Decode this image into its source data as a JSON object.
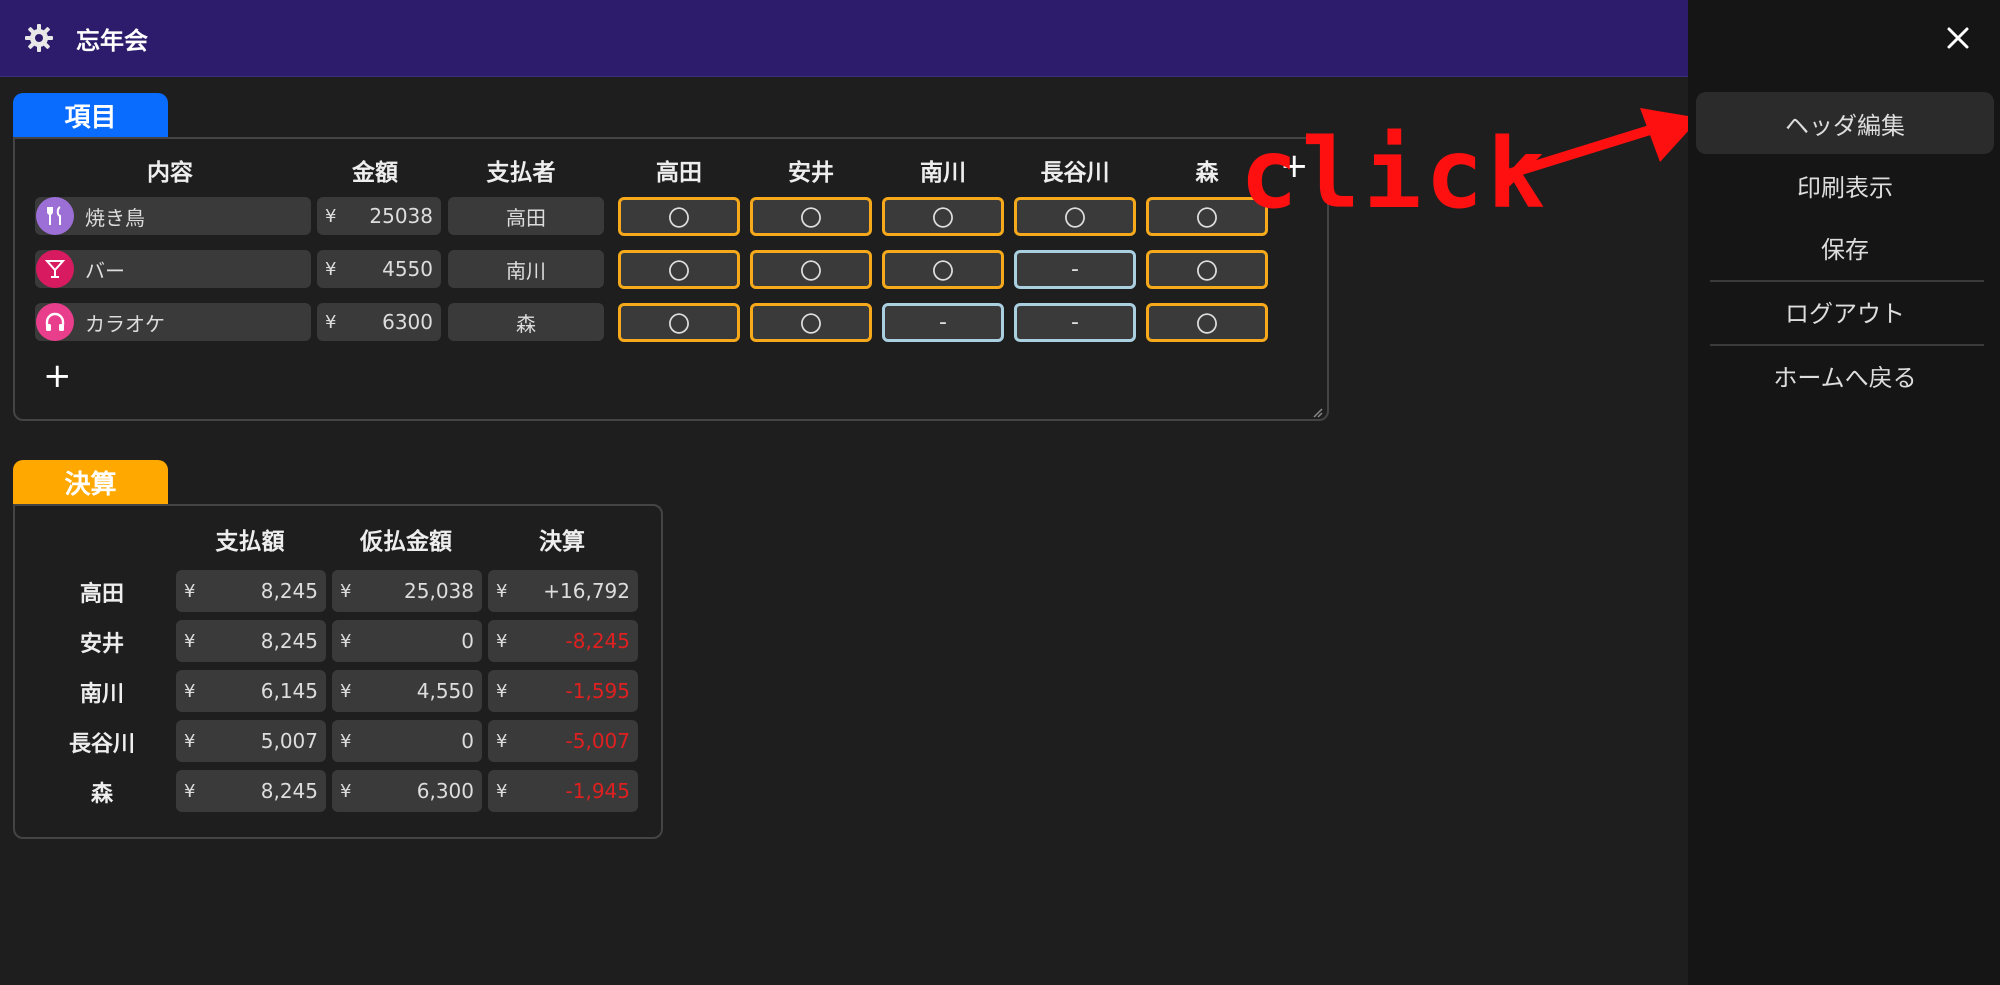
{
  "app": {
    "title": "忘年会"
  },
  "items_section": {
    "tab_label": "項目",
    "headers": {
      "content": "内容",
      "amount": "金額",
      "payer": "支払者"
    },
    "members": [
      "高田",
      "安井",
      "南川",
      "長谷川",
      "森"
    ],
    "add_member_symbol": "+",
    "add_row_symbol": "+",
    "currency": "¥",
    "rows": [
      {
        "icon": "utensils-icon",
        "icon_color": "#9b6fd6",
        "name": "焼き鳥",
        "amount": "25038",
        "payer": "高田",
        "marks": [
          "〇",
          "〇",
          "〇",
          "〇",
          "〇"
        ]
      },
      {
        "icon": "cocktail-icon",
        "icon_color": "#d81b60",
        "name": "バー",
        "amount": "4550",
        "payer": "南川",
        "marks": [
          "〇",
          "〇",
          "〇",
          "-",
          "〇"
        ]
      },
      {
        "icon": "headphones-icon",
        "icon_color": "#e83e8c",
        "name": "カラオケ",
        "amount": "6300",
        "payer": "森",
        "marks": [
          "〇",
          "〇",
          "-",
          "-",
          "〇"
        ]
      }
    ]
  },
  "settlement_section": {
    "tab_label": "決算",
    "headers": {
      "paid": "支払額",
      "advance": "仮払金額",
      "settle": "決算"
    },
    "currency": "¥",
    "rows": [
      {
        "name": "高田",
        "paid": "8,245",
        "advance": "25,038",
        "settle": "+16,792",
        "negative": false
      },
      {
        "name": "安井",
        "paid": "8,245",
        "advance": "0",
        "settle": "-8,245",
        "negative": true
      },
      {
        "name": "南川",
        "paid": "6,145",
        "advance": "4,550",
        "settle": "-1,595",
        "negative": true
      },
      {
        "name": "長谷川",
        "paid": "5,007",
        "advance": "0",
        "settle": "-5,007",
        "negative": true
      },
      {
        "name": "森",
        "paid": "8,245",
        "advance": "6,300",
        "settle": "-1,945",
        "negative": true
      }
    ]
  },
  "side_menu": {
    "items": [
      "ヘッダ編集",
      "印刷表示",
      "保存",
      "ログアウト",
      "ホームへ戻る"
    ]
  },
  "annotation": {
    "text": "click"
  },
  "colors": {
    "header_bg": "#2d1b6b",
    "items_tab": "#0a6cff",
    "settle_tab": "#ffa800",
    "mark_on": "#f5a91b",
    "mark_off": "#a9cfe0",
    "negative": "#e02020",
    "annotation": "#ff1010"
  }
}
